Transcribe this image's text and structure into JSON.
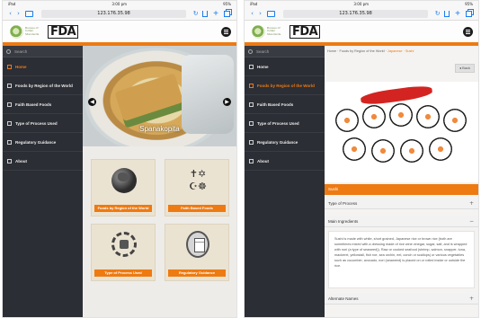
{
  "status": {
    "carrier": "iPad",
    "time": "3:00 pm",
    "battery": "95%"
  },
  "browser": {
    "url": "123.176.35.98"
  },
  "header": {
    "logo_text": "Bureau of Indian Standards",
    "fda": "FDA"
  },
  "sidebar": {
    "search_placeholder": "Search",
    "items": [
      {
        "label": "Home"
      },
      {
        "label": "Foods by Region of the World"
      },
      {
        "label": "Faith Based Foods"
      },
      {
        "label": "Type of Process Used"
      },
      {
        "label": "Regulatory Guidance"
      },
      {
        "label": "About"
      }
    ]
  },
  "left": {
    "carousel_caption": "Spanakopita",
    "tiles": [
      {
        "label": "Foods by Region of the World",
        "icon": "globe-icon"
      },
      {
        "label": "Faith Based Foods",
        "icon": "religious-symbols-icon"
      },
      {
        "label": "Type of Process Used",
        "icon": "process-cycle-icon"
      },
      {
        "label": "Regulatory Guidance",
        "icon": "document-icon"
      }
    ]
  },
  "right": {
    "breadcrumb": "Home · Foods by Region of the World ·",
    "breadcrumb_current": "Japanese · Sushi",
    "back_label": "◂ Back",
    "panel_title": "Sushi",
    "accordion": {
      "type_of_process": "Type of Process",
      "main_ingredients": "Main Ingredients",
      "alternate_names": "Alternate Names",
      "body": "Sushi is made with white, short grained, Japanese rice or brown rice (both are sometimes mixed with a dressing made of rice wine vinegar, sugar, salt, and is wrapped with nori (a type of seaweed)). Raw or cooked seafood (shrimp, salmon, snapper, tuna, mackerel, yellowtail, fish roe, sea urchin, eel, conch or scallops) or various vegetables such as cucumber, avocado, nori (seaweed) is placed on or rolled inside or outside the rice."
    }
  },
  "colors": {
    "accent": "#ee7a12",
    "sidebar": "#2c2e35"
  }
}
